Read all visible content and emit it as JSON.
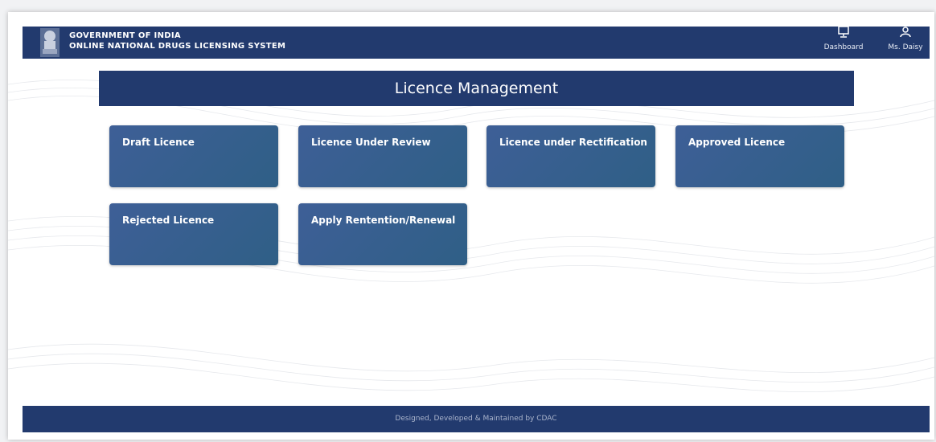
{
  "header": {
    "title_line1": "GOVERNMENT OF INDIA",
    "title_line2": "ONLINE NATIONAL DRUGS LICENSING SYSTEM",
    "nav": {
      "dashboard_label": "Dashboard",
      "dashboard_icon": "monitor-icon",
      "user_label": "Ms. Daisy",
      "user_icon": "user-icon"
    }
  },
  "main": {
    "title": "Licence Management",
    "cards": [
      {
        "label": "Draft Licence"
      },
      {
        "label": "Licence Under Review"
      },
      {
        "label": "Licence under Rectification"
      },
      {
        "label": "Approved Licence"
      },
      {
        "label": "Rejected Licence"
      },
      {
        "label": "Apply Rentention/Renewal"
      }
    ]
  },
  "footer": {
    "text": "Designed, Developed & Maintained by CDAC"
  },
  "colors": {
    "brand_navy": "#223a6e",
    "card_gradient_start": "#3e5f97",
    "card_gradient_end": "#2f5f86",
    "background": "#ffffff"
  }
}
